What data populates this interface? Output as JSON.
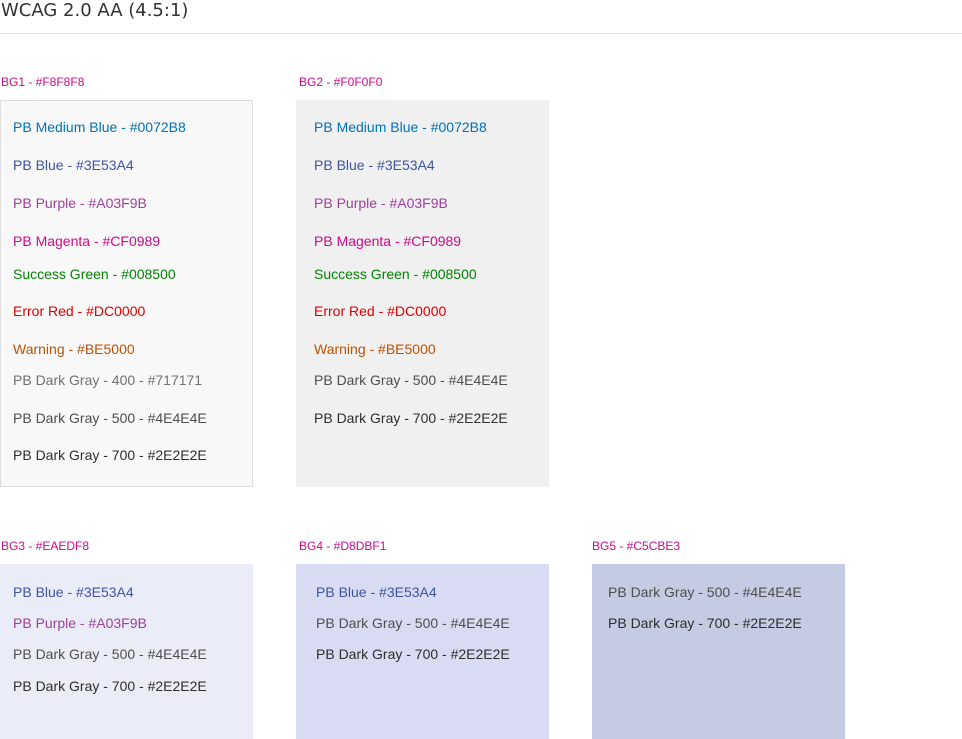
{
  "page": {
    "title": "WCAG 2.0 AA (4.5:1)"
  },
  "colors": {
    "label": "#CF0989",
    "bg1": "#F8F8F8",
    "bg2": "#F0F0F0",
    "bg3": "#EAEDF8",
    "bg4": "#D8DBF1",
    "bg5": "#C5CBE3",
    "pb_medium_blue": "#0072B8",
    "pb_blue": "#3E53A4",
    "pb_purple": "#A03F9B",
    "pb_magenta": "#CF0989",
    "success_green": "#008500",
    "error_red": "#DC0000",
    "warning": "#BE5000",
    "gray_400": "#717171",
    "gray_500": "#4E4E4E",
    "gray_700": "#2E2E2E"
  },
  "panels": [
    {
      "label": "BG1 - #F8F8F8",
      "items": [
        "PB Medium Blue - #0072B8",
        "PB Blue - #3E53A4",
        "PB Purple - #A03F9B",
        "PB Magenta - #CF0989",
        "Success Green - #008500",
        "Error Red - #DC0000",
        "Warning - #BE5000",
        "PB Dark Gray - 400 - #717171",
        "PB Dark Gray - 500 - #4E4E4E",
        "PB Dark Gray - 700 - #2E2E2E"
      ]
    },
    {
      "label": "BG2 - #F0F0F0",
      "items": [
        "PB Medium Blue - #0072B8",
        "PB Blue - #3E53A4",
        "PB Purple - #A03F9B",
        "PB Magenta - #CF0989",
        "Success Green - #008500",
        "Error Red - #DC0000",
        "Warning - #BE5000",
        "PB Dark Gray - 500 - #4E4E4E",
        "PB Dark Gray - 700 - #2E2E2E"
      ]
    },
    {
      "label": "BG3 - #EAEDF8",
      "items": [
        "PB Blue - #3E53A4",
        "PB Purple - #A03F9B",
        "PB Dark Gray - 500 - #4E4E4E",
        "PB Dark Gray - 700 - #2E2E2E"
      ]
    },
    {
      "label": "BG4 - #D8DBF1",
      "items": [
        "PB Blue - #3E53A4",
        "PB Dark Gray - 500 - #4E4E4E",
        "PB Dark Gray - 700 - #2E2E2E"
      ]
    },
    {
      "label": "BG5 - #C5CBE3",
      "items": [
        "PB Dark Gray - 500 - #4E4E4E",
        "PB Dark Gray - 700 - #2E2E2E"
      ]
    }
  ]
}
